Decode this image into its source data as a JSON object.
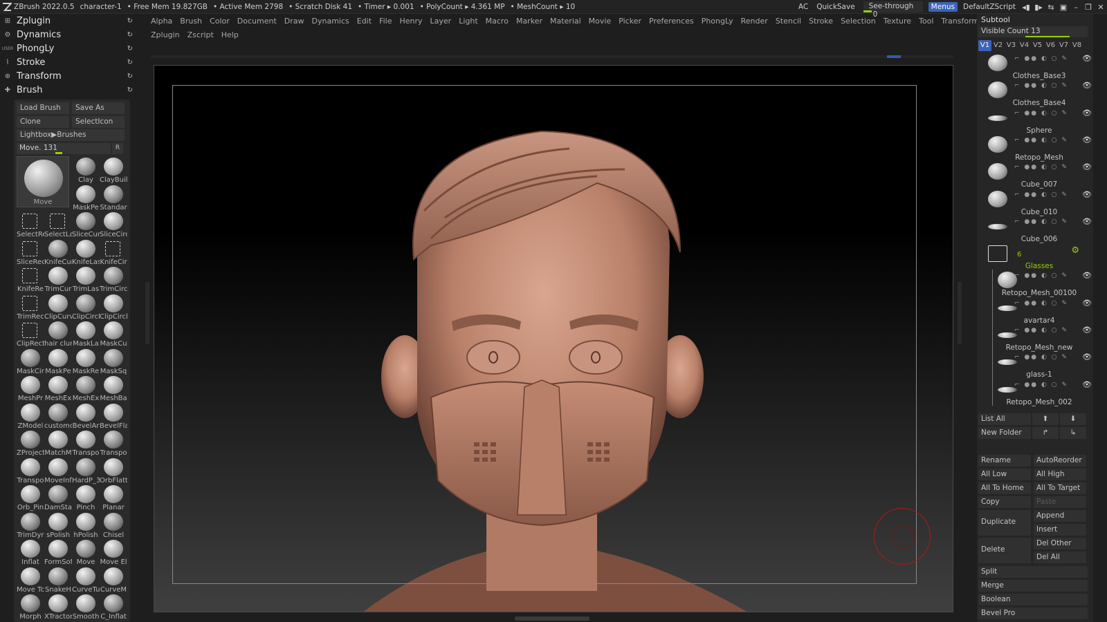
{
  "titlebar": {
    "app": "ZBrush 2022.0.5",
    "doc": "character-1",
    "free_mem": "• Free Mem 19.827GB",
    "active_mem": "• Active Mem 2798",
    "scratch": "• Scratch Disk 41",
    "timer": "• Timer ▸ 0.001",
    "polycount": "• PolyCount ▸ 4.361 MP",
    "meshcount": "• MeshCount ▸ 10",
    "ac": "AC",
    "quicksave": "QuickSave",
    "see_through": "See-through",
    "see_through_value": "0",
    "menus": "Menus",
    "script": "DefaultZScript"
  },
  "palettes": [
    {
      "label": "Zplugin"
    },
    {
      "label": "Dynamics"
    },
    {
      "label": "PhongLy",
      "tag": "USER"
    },
    {
      "label": "Stroke"
    },
    {
      "label": "Transform"
    },
    {
      "label": "Brush"
    }
  ],
  "menu_row1": [
    "Alpha",
    "Brush",
    "Color",
    "Document",
    "Draw",
    "Dynamics",
    "Edit",
    "File",
    "Henry",
    "Layer",
    "Light",
    "Macro",
    "Marker",
    "Material",
    "Movie",
    "Picker",
    "Preferences",
    "PhongLy",
    "Render",
    "Stencil",
    "Stroke",
    "Selection",
    "Texture",
    "Tool",
    "Transform"
  ],
  "menu_row2": [
    "Zplugin",
    "Zscript",
    "Help"
  ],
  "brush": {
    "load": "Load Brush",
    "save_as": "Save As",
    "clone": "Clone",
    "select_icon": "SelectIcon",
    "lightbox": "Lightbox▶Brushes",
    "slider_label": "Move",
    "slider_value": "131",
    "r": "R",
    "current": "Move",
    "brushes": [
      "Clay",
      "ClayBuil",
      "MaskPe",
      "Standar",
      "SelectRe",
      "SelectLa",
      "SliceCur",
      "SliceCirc",
      "SliceRec",
      "KnifeCur",
      "KnifeLas",
      "KnifeCir",
      "KnifeRe",
      "TrimCur",
      "TrimLas",
      "TrimCirc",
      "TrimRec",
      "ClipCurv",
      "ClipCircl",
      "ClipCircl",
      "ClipRect",
      "hair clur",
      "MaskLa",
      "MaskCu",
      "MaskCir",
      "MaskPe",
      "MaskRe",
      "MaskSq",
      "MeshPr",
      "MeshEx",
      "MeshEx",
      "MeshBa",
      "ZModel",
      "customc",
      "BevelAr",
      "BevelFla",
      "ZProject",
      "MatchM",
      "Transpo",
      "Transpo",
      "Transpo",
      "MoveInf",
      "HardP_3",
      "OrbFlatt",
      "Orb_Pin",
      "DamSta",
      "Pinch",
      "Planar",
      "TrimDyr",
      "sPolish",
      "hPolish",
      "Chisel",
      "Inflat",
      "FormSof",
      "Move",
      "Move El",
      "Move Tc",
      "SnakeH",
      "CurveTu",
      "CurveM",
      "Morph",
      "XTractor",
      "Smooth",
      "C_Inflat"
    ]
  },
  "subtool": {
    "title": "Subtool",
    "visible_count": "Visible Count 13",
    "versions": [
      "V1",
      "V2",
      "V3",
      "V4",
      "V5",
      "V6",
      "V7",
      "V8"
    ],
    "items": [
      "Clothes_Base3",
      "Clothes_Base4",
      "Sphere",
      "Retopo_Mesh",
      "Cube_007",
      "Cube_010",
      "Cube_006"
    ],
    "folder_count": "6",
    "folder_name": "Glasses",
    "folder_items": [
      "Retopo_Mesh_00100",
      "avartar4",
      "Retopo_Mesh_new",
      "glass-1",
      "Retopo_Mesh_002"
    ],
    "list_all": "List All",
    "new_folder": "New Folder",
    "rename": "Rename",
    "auto_reorder": "AutoReorder",
    "all_low": "All Low",
    "all_high": "All High",
    "all_to_home": "All To Home",
    "all_to_target": "All To Target",
    "copy": "Copy",
    "paste": "Paste",
    "duplicate": "Duplicate",
    "append": "Append",
    "insert": "Insert",
    "delete": "Delete",
    "del_other": "Del Other",
    "del_all": "Del All",
    "split": "Split",
    "merge": "Merge",
    "boolean": "Boolean",
    "bevel_pro": "Bevel Pro"
  },
  "colors": {
    "accent": "#3d63b8",
    "highlight": "#9ad000",
    "cursor": "#b01818"
  }
}
